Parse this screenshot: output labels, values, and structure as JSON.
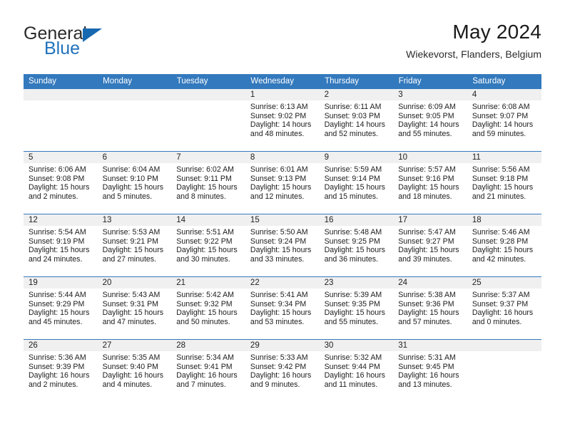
{
  "brand": {
    "name_top": "General",
    "name_bottom": "Blue",
    "accent_color": "#1668b0"
  },
  "header": {
    "month_title": "May 2024",
    "location": "Wiekevorst, Flanders, Belgium"
  },
  "theme": {
    "header_blue": "#3379bd",
    "daynum_band": "#f0f0f0",
    "text": "#1c1c1c"
  },
  "weekdays": [
    "Sunday",
    "Monday",
    "Tuesday",
    "Wednesday",
    "Thursday",
    "Friday",
    "Saturday"
  ],
  "weeks": [
    [
      {
        "day": "",
        "sunrise": "",
        "sunset": "",
        "daylight_line1": "",
        "daylight_line2": ""
      },
      {
        "day": "",
        "sunrise": "",
        "sunset": "",
        "daylight_line1": "",
        "daylight_line2": ""
      },
      {
        "day": "",
        "sunrise": "",
        "sunset": "",
        "daylight_line1": "",
        "daylight_line2": ""
      },
      {
        "day": "1",
        "sunrise": "Sunrise: 6:13 AM",
        "sunset": "Sunset: 9:02 PM",
        "daylight_line1": "Daylight: 14 hours",
        "daylight_line2": "and 48 minutes."
      },
      {
        "day": "2",
        "sunrise": "Sunrise: 6:11 AM",
        "sunset": "Sunset: 9:03 PM",
        "daylight_line1": "Daylight: 14 hours",
        "daylight_line2": "and 52 minutes."
      },
      {
        "day": "3",
        "sunrise": "Sunrise: 6:09 AM",
        "sunset": "Sunset: 9:05 PM",
        "daylight_line1": "Daylight: 14 hours",
        "daylight_line2": "and 55 minutes."
      },
      {
        "day": "4",
        "sunrise": "Sunrise: 6:08 AM",
        "sunset": "Sunset: 9:07 PM",
        "daylight_line1": "Daylight: 14 hours",
        "daylight_line2": "and 59 minutes."
      }
    ],
    [
      {
        "day": "5",
        "sunrise": "Sunrise: 6:06 AM",
        "sunset": "Sunset: 9:08 PM",
        "daylight_line1": "Daylight: 15 hours",
        "daylight_line2": "and 2 minutes."
      },
      {
        "day": "6",
        "sunrise": "Sunrise: 6:04 AM",
        "sunset": "Sunset: 9:10 PM",
        "daylight_line1": "Daylight: 15 hours",
        "daylight_line2": "and 5 minutes."
      },
      {
        "day": "7",
        "sunrise": "Sunrise: 6:02 AM",
        "sunset": "Sunset: 9:11 PM",
        "daylight_line1": "Daylight: 15 hours",
        "daylight_line2": "and 8 minutes."
      },
      {
        "day": "8",
        "sunrise": "Sunrise: 6:01 AM",
        "sunset": "Sunset: 9:13 PM",
        "daylight_line1": "Daylight: 15 hours",
        "daylight_line2": "and 12 minutes."
      },
      {
        "day": "9",
        "sunrise": "Sunrise: 5:59 AM",
        "sunset": "Sunset: 9:14 PM",
        "daylight_line1": "Daylight: 15 hours",
        "daylight_line2": "and 15 minutes."
      },
      {
        "day": "10",
        "sunrise": "Sunrise: 5:57 AM",
        "sunset": "Sunset: 9:16 PM",
        "daylight_line1": "Daylight: 15 hours",
        "daylight_line2": "and 18 minutes."
      },
      {
        "day": "11",
        "sunrise": "Sunrise: 5:56 AM",
        "sunset": "Sunset: 9:18 PM",
        "daylight_line1": "Daylight: 15 hours",
        "daylight_line2": "and 21 minutes."
      }
    ],
    [
      {
        "day": "12",
        "sunrise": "Sunrise: 5:54 AM",
        "sunset": "Sunset: 9:19 PM",
        "daylight_line1": "Daylight: 15 hours",
        "daylight_line2": "and 24 minutes."
      },
      {
        "day": "13",
        "sunrise": "Sunrise: 5:53 AM",
        "sunset": "Sunset: 9:21 PM",
        "daylight_line1": "Daylight: 15 hours",
        "daylight_line2": "and 27 minutes."
      },
      {
        "day": "14",
        "sunrise": "Sunrise: 5:51 AM",
        "sunset": "Sunset: 9:22 PM",
        "daylight_line1": "Daylight: 15 hours",
        "daylight_line2": "and 30 minutes."
      },
      {
        "day": "15",
        "sunrise": "Sunrise: 5:50 AM",
        "sunset": "Sunset: 9:24 PM",
        "daylight_line1": "Daylight: 15 hours",
        "daylight_line2": "and 33 minutes."
      },
      {
        "day": "16",
        "sunrise": "Sunrise: 5:48 AM",
        "sunset": "Sunset: 9:25 PM",
        "daylight_line1": "Daylight: 15 hours",
        "daylight_line2": "and 36 minutes."
      },
      {
        "day": "17",
        "sunrise": "Sunrise: 5:47 AM",
        "sunset": "Sunset: 9:27 PM",
        "daylight_line1": "Daylight: 15 hours",
        "daylight_line2": "and 39 minutes."
      },
      {
        "day": "18",
        "sunrise": "Sunrise: 5:46 AM",
        "sunset": "Sunset: 9:28 PM",
        "daylight_line1": "Daylight: 15 hours",
        "daylight_line2": "and 42 minutes."
      }
    ],
    [
      {
        "day": "19",
        "sunrise": "Sunrise: 5:44 AM",
        "sunset": "Sunset: 9:29 PM",
        "daylight_line1": "Daylight: 15 hours",
        "daylight_line2": "and 45 minutes."
      },
      {
        "day": "20",
        "sunrise": "Sunrise: 5:43 AM",
        "sunset": "Sunset: 9:31 PM",
        "daylight_line1": "Daylight: 15 hours",
        "daylight_line2": "and 47 minutes."
      },
      {
        "day": "21",
        "sunrise": "Sunrise: 5:42 AM",
        "sunset": "Sunset: 9:32 PM",
        "daylight_line1": "Daylight: 15 hours",
        "daylight_line2": "and 50 minutes."
      },
      {
        "day": "22",
        "sunrise": "Sunrise: 5:41 AM",
        "sunset": "Sunset: 9:34 PM",
        "daylight_line1": "Daylight: 15 hours",
        "daylight_line2": "and 53 minutes."
      },
      {
        "day": "23",
        "sunrise": "Sunrise: 5:39 AM",
        "sunset": "Sunset: 9:35 PM",
        "daylight_line1": "Daylight: 15 hours",
        "daylight_line2": "and 55 minutes."
      },
      {
        "day": "24",
        "sunrise": "Sunrise: 5:38 AM",
        "sunset": "Sunset: 9:36 PM",
        "daylight_line1": "Daylight: 15 hours",
        "daylight_line2": "and 57 minutes."
      },
      {
        "day": "25",
        "sunrise": "Sunrise: 5:37 AM",
        "sunset": "Sunset: 9:37 PM",
        "daylight_line1": "Daylight: 16 hours",
        "daylight_line2": "and 0 minutes."
      }
    ],
    [
      {
        "day": "26",
        "sunrise": "Sunrise: 5:36 AM",
        "sunset": "Sunset: 9:39 PM",
        "daylight_line1": "Daylight: 16 hours",
        "daylight_line2": "and 2 minutes."
      },
      {
        "day": "27",
        "sunrise": "Sunrise: 5:35 AM",
        "sunset": "Sunset: 9:40 PM",
        "daylight_line1": "Daylight: 16 hours",
        "daylight_line2": "and 4 minutes."
      },
      {
        "day": "28",
        "sunrise": "Sunrise: 5:34 AM",
        "sunset": "Sunset: 9:41 PM",
        "daylight_line1": "Daylight: 16 hours",
        "daylight_line2": "and 7 minutes."
      },
      {
        "day": "29",
        "sunrise": "Sunrise: 5:33 AM",
        "sunset": "Sunset: 9:42 PM",
        "daylight_line1": "Daylight: 16 hours",
        "daylight_line2": "and 9 minutes."
      },
      {
        "day": "30",
        "sunrise": "Sunrise: 5:32 AM",
        "sunset": "Sunset: 9:44 PM",
        "daylight_line1": "Daylight: 16 hours",
        "daylight_line2": "and 11 minutes."
      },
      {
        "day": "31",
        "sunrise": "Sunrise: 5:31 AM",
        "sunset": "Sunset: 9:45 PM",
        "daylight_line1": "Daylight: 16 hours",
        "daylight_line2": "and 13 minutes."
      },
      {
        "day": "",
        "sunrise": "",
        "sunset": "",
        "daylight_line1": "",
        "daylight_line2": ""
      }
    ]
  ]
}
